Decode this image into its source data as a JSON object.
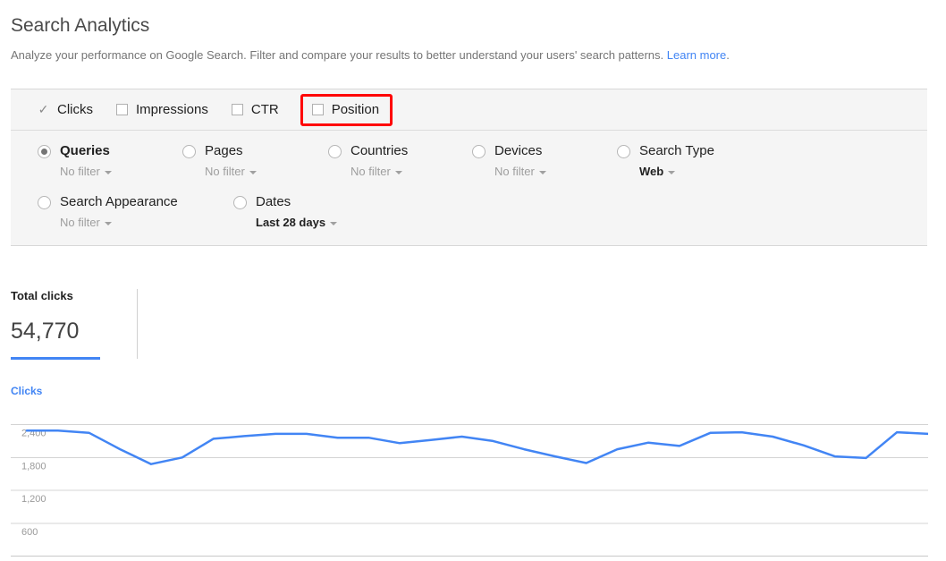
{
  "header": {
    "title": "Search Analytics",
    "subtitle_before": "Analyze your performance on Google Search. Filter and compare your results to better understand your users' search patterns. ",
    "learn_more": "Learn more",
    "subtitle_after": "."
  },
  "metrics": [
    {
      "label": "Clicks",
      "icon": "check-icon",
      "checked": true
    },
    {
      "label": "Impressions",
      "icon": "checkbox-icon",
      "checked": false
    },
    {
      "label": "CTR",
      "icon": "checkbox-icon",
      "checked": false
    },
    {
      "label": "Position",
      "icon": "checkbox-icon",
      "checked": false,
      "highlighted": true
    }
  ],
  "dimensions_row1": [
    {
      "label": "Queries",
      "filter": "No filter",
      "selected": true,
      "filter_active": false
    },
    {
      "label": "Pages",
      "filter": "No filter",
      "selected": false,
      "filter_active": false
    },
    {
      "label": "Countries",
      "filter": "No filter",
      "selected": false,
      "filter_active": false
    },
    {
      "label": "Devices",
      "filter": "No filter",
      "selected": false,
      "filter_active": false
    },
    {
      "label": "Search Type",
      "filter": "Web",
      "selected": false,
      "filter_active": true
    }
  ],
  "dimensions_row2": [
    {
      "label": "Search Appearance",
      "filter": "No filter",
      "selected": false,
      "filter_active": false
    },
    {
      "label": "Dates",
      "filter": "Last 28 days",
      "selected": false,
      "filter_active": true
    }
  ],
  "summary": {
    "title": "Total clicks",
    "value": "54,770"
  },
  "colors": {
    "accent": "#4285f4",
    "highlight": "#ff0000",
    "panel_bg": "#f5f5f5",
    "gridline": "#d4d4d4"
  },
  "chart_data": {
    "type": "line",
    "title": "",
    "legend": "Clicks",
    "legend_position": "top-left",
    "grid": true,
    "xlabel": "",
    "ylabel": "",
    "ylim": [
      0,
      2700
    ],
    "yticks": [
      2400,
      1800,
      1200,
      600
    ],
    "ytick_labels": [
      "2,400",
      "1,800",
      "1,200",
      "600"
    ],
    "series": [
      {
        "name": "Clicks",
        "color": "#4285f4",
        "values": [
          2290,
          2290,
          2250,
          1950,
          1680,
          1800,
          2140,
          2190,
          2230,
          2230,
          2160,
          2160,
          2060,
          2120,
          2180,
          2100,
          1950,
          1820,
          1700,
          1950,
          2070,
          2010,
          2250,
          2260,
          2180,
          2020,
          1820,
          1790,
          2260,
          2230
        ]
      }
    ]
  }
}
